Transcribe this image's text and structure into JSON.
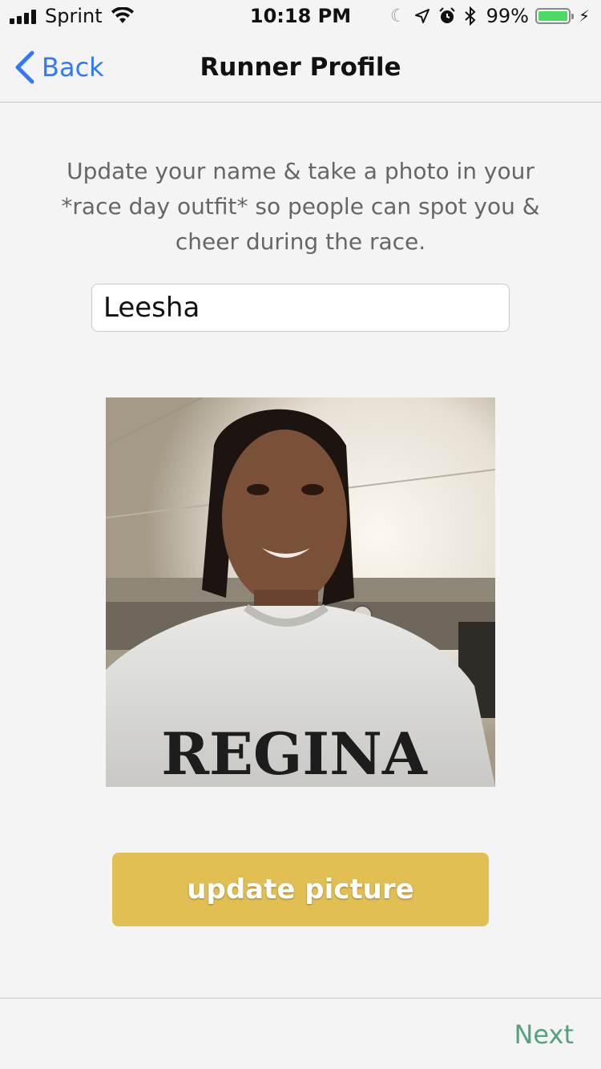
{
  "status_bar": {
    "carrier": "Sprint",
    "time": "10:18 PM",
    "battery_percent": "99%",
    "battery_level": 0.99,
    "icons": [
      "signal-icon",
      "wifi-icon",
      "moon-icon",
      "location-icon",
      "alarm-icon",
      "bluetooth-icon",
      "battery-icon",
      "charging-icon"
    ]
  },
  "nav": {
    "back_label": "Back",
    "title": "Runner Profile"
  },
  "intro": {
    "line1": "Update your name & take a photo in your",
    "line2": "*race day outfit* so people can spot you &",
    "line3": "cheer during the race."
  },
  "name_field": {
    "value": "Leesha"
  },
  "photo": {
    "shirt_text": "REGINA"
  },
  "update_button": {
    "label": "update picture"
  },
  "footer": {
    "next_label": "Next"
  },
  "colors": {
    "accent_blue": "#3478f6",
    "button_gold": "#e1bf52",
    "next_green": "#55a27d",
    "battery_green": "#4cd964"
  }
}
